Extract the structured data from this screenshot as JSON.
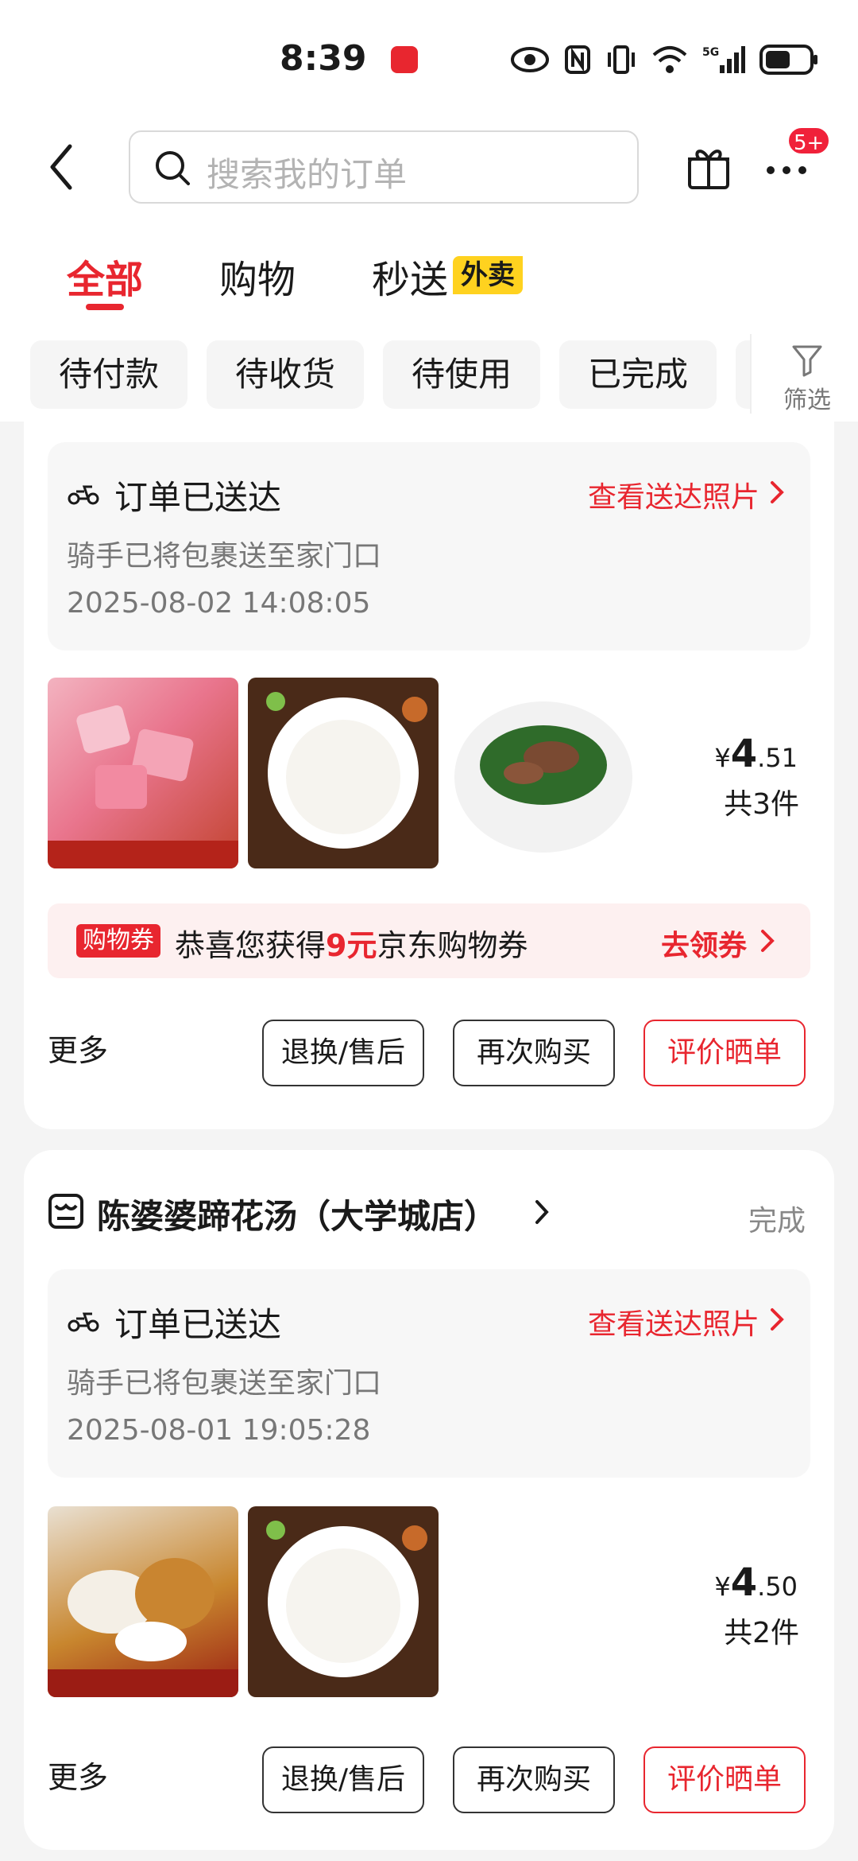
{
  "status_bar": {
    "time": "8:39",
    "icons": [
      "app-notification-icon",
      "eye-icon",
      "nfc-icon",
      "vibrate-icon",
      "wifi-icon",
      "5g-signal-icon",
      "battery-icon"
    ]
  },
  "header": {
    "search_placeholder": "搜索我的订单",
    "notification_badge": "5+"
  },
  "tabs": [
    {
      "label": "全部",
      "active": true
    },
    {
      "label": "购物",
      "active": false
    },
    {
      "label": "秒送",
      "active": false,
      "tag": "外卖"
    }
  ],
  "filters": {
    "chips": [
      "待付款",
      "待收货",
      "待使用",
      "已完成"
    ],
    "filter_label": "筛选"
  },
  "orders": [
    {
      "delivery_status": "订单已送达",
      "photo_link": "查看送达照片",
      "delivery_note": "骑手已将包裹送至家门口",
      "delivered_at": "2025-08-02 14:08:05",
      "price_symbol": "¥",
      "price_int": "4",
      "price_dec": ".51",
      "item_count": "共3件",
      "coupon": {
        "tag": "购物券",
        "text_pre": "恭喜您获得",
        "amount": "9元",
        "text_post": "京东购物券",
        "cta": "去领券"
      },
      "more": "更多",
      "actions": [
        "退换/售后",
        "再次购买",
        "评价晒单"
      ]
    },
    {
      "shop_name": "陈婆婆蹄花汤（大学城店）",
      "shop_status": "完成",
      "delivery_status": "订单已送达",
      "photo_link": "查看送达照片",
      "delivery_note": "骑手已将包裹送至家门口",
      "delivered_at": "2025-08-01 19:05:28",
      "price_symbol": "¥",
      "price_int": "4",
      "price_dec": ".50",
      "item_count": "共2件",
      "more": "更多",
      "actions": [
        "退换/售后",
        "再次购买",
        "评价晒单"
      ]
    }
  ],
  "colors": {
    "accent": "#e8262f",
    "waimai_tag": "#ffd21f",
    "background": "#f4f4f4"
  }
}
